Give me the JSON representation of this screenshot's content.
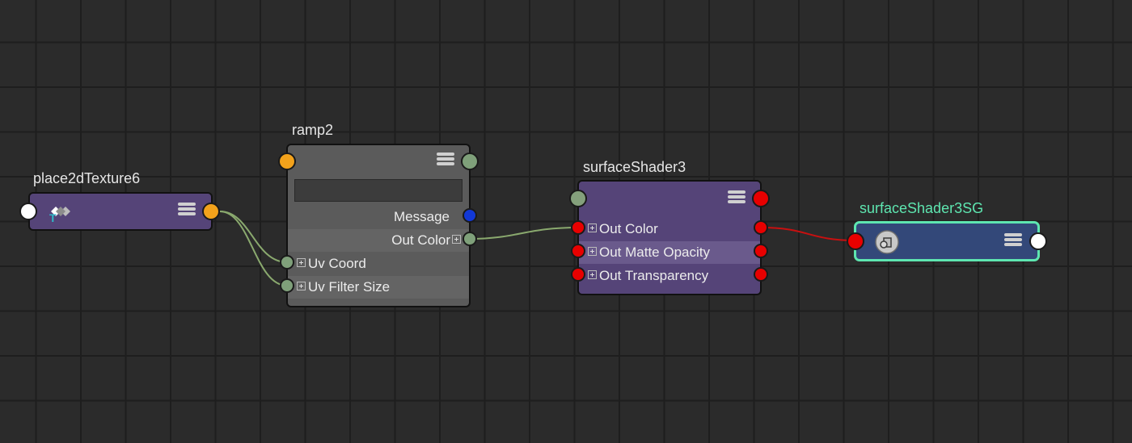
{
  "nodes": {
    "place2d": {
      "title": "place2dTexture6",
      "icon": "place2d-texture-icon"
    },
    "ramp": {
      "title": "ramp2",
      "attrs": [
        {
          "label": "Message"
        },
        {
          "label": "Out Color"
        },
        {
          "label": "Uv Coord"
        },
        {
          "label": "Uv Filter Size"
        }
      ]
    },
    "shader": {
      "title": "surfaceShader3",
      "attrs": [
        {
          "label": "Out Color"
        },
        {
          "label": "Out Matte Opacity"
        },
        {
          "label": "Out Transparency"
        }
      ]
    },
    "sg": {
      "title": "surfaceShader3SG",
      "icon": "shading-group-icon"
    }
  },
  "colors": {
    "background": "#2b2b2b",
    "grid": "#1e1e1e",
    "node_purple": "#554478",
    "node_gray": "#5d5d5d",
    "node_sg": "#334879",
    "selection": "#5ee6b0",
    "wire_green": "#8aa96e",
    "wire_red": "#c81010"
  }
}
